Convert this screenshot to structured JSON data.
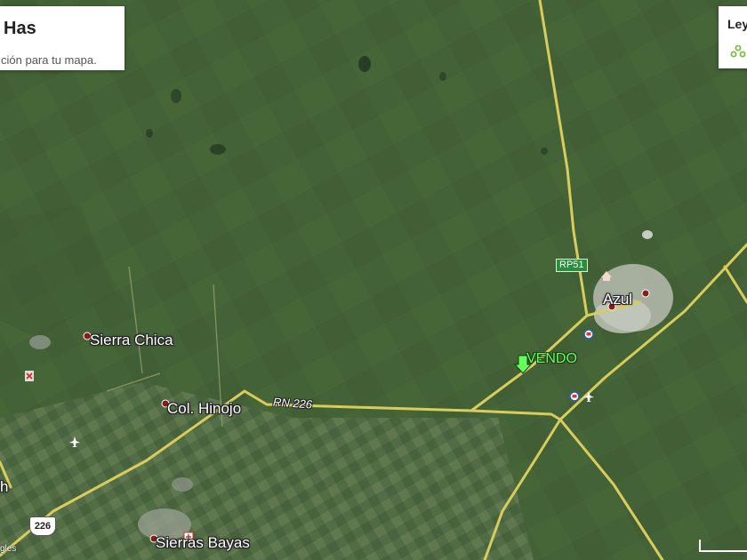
{
  "info_panel": {
    "title": "Has",
    "description": "ción para tu mapa."
  },
  "legend": {
    "title": "Ley",
    "icon": "layers-icon"
  },
  "places": {
    "sierra_chica": "Sierra Chica",
    "col_hinojo": "Col. Hinojo",
    "sierras_bayas": "Sierras Bayas",
    "azul": "Azul",
    "cut_off_h": "h"
  },
  "roads": {
    "rn226_label": "RN 226",
    "rp51_label": "RP51",
    "shield_226": "226"
  },
  "marker": {
    "label": "VENDO",
    "icon": "green-map-pin-icon"
  },
  "attribution": "gles",
  "colors": {
    "road": "#d8cd5a",
    "marker": "#62ff5c",
    "route_badge": "#2a8f3a",
    "place_dot": "#8b1a1a",
    "field": "#4a6a3d"
  }
}
